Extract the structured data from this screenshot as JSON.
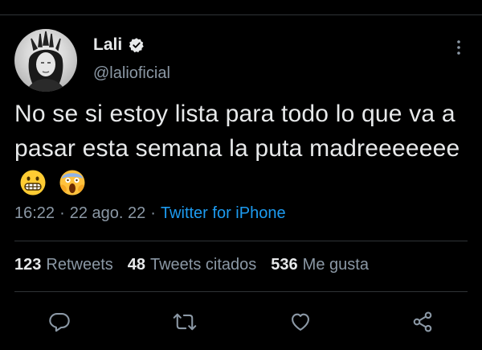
{
  "author": {
    "display_name": "Lali",
    "handle": "@lalioficial",
    "verified": true
  },
  "tweet": {
    "text": "No se si estoy lista para todo lo que va a pasar esta semana la puta madreeeeeee",
    "emojis": [
      "grimacing-face",
      "face-screaming-in-fear"
    ]
  },
  "meta": {
    "time": "16:22",
    "date": "22 ago. 22",
    "separator": "·",
    "source": "Twitter for iPhone"
  },
  "stats": {
    "retweets": {
      "count": "123",
      "label": "Retweets"
    },
    "quotes": {
      "count": "48",
      "label": "Tweets citados"
    },
    "likes": {
      "count": "536",
      "label": "Me gusta"
    }
  },
  "actions": [
    "reply-icon",
    "retweet-icon",
    "like-icon",
    "share-icon"
  ],
  "colors": {
    "background": "#000000",
    "text": "#e7e9ea",
    "muted": "#8b98a5",
    "accent": "#1d9bf0",
    "divider": "#2f3336"
  }
}
